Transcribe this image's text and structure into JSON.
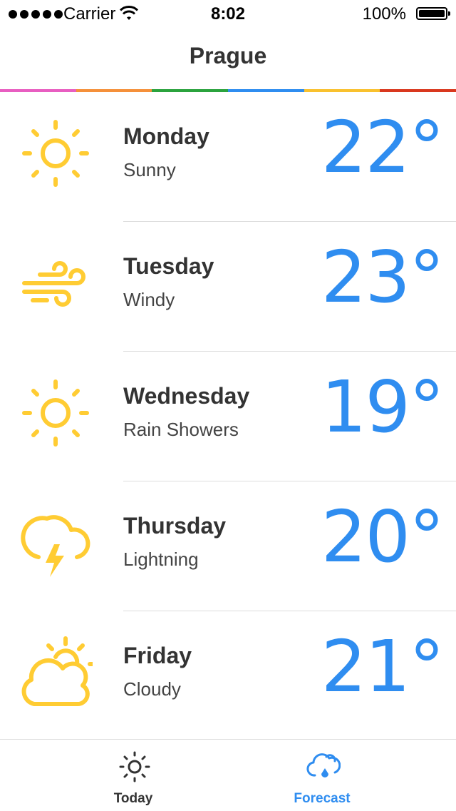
{
  "status_bar": {
    "carrier": "Carrier",
    "time": "8:02",
    "battery": "100%"
  },
  "nav": {
    "title": "Prague"
  },
  "colors": {
    "accent": "#2f8df0",
    "icon_yellow": "#ffcc33",
    "stripe": [
      "#e85ec1",
      "#f5903a",
      "#2ba33e",
      "#2f8df0",
      "#f9c12e",
      "#d9381e"
    ]
  },
  "forecast": [
    {
      "day": "Monday",
      "condition": "Sunny",
      "temp": "22°",
      "icon": "sun-icon"
    },
    {
      "day": "Tuesday",
      "condition": "Windy",
      "temp": "23°",
      "icon": "wind-icon"
    },
    {
      "day": "Wednesday",
      "condition": "Rain Showers",
      "temp": "19°",
      "icon": "sun-icon"
    },
    {
      "day": "Thursday",
      "condition": "Lightning",
      "temp": "20°",
      "icon": "lightning-cloud-icon"
    },
    {
      "day": "Friday",
      "condition": "Cloudy",
      "temp": "21°",
      "icon": "partly-cloudy-icon"
    }
  ],
  "tabs": [
    {
      "label": "Today",
      "icon": "sun-icon",
      "selected": false
    },
    {
      "label": "Forecast",
      "icon": "cloud-rain-icon",
      "selected": true
    }
  ]
}
